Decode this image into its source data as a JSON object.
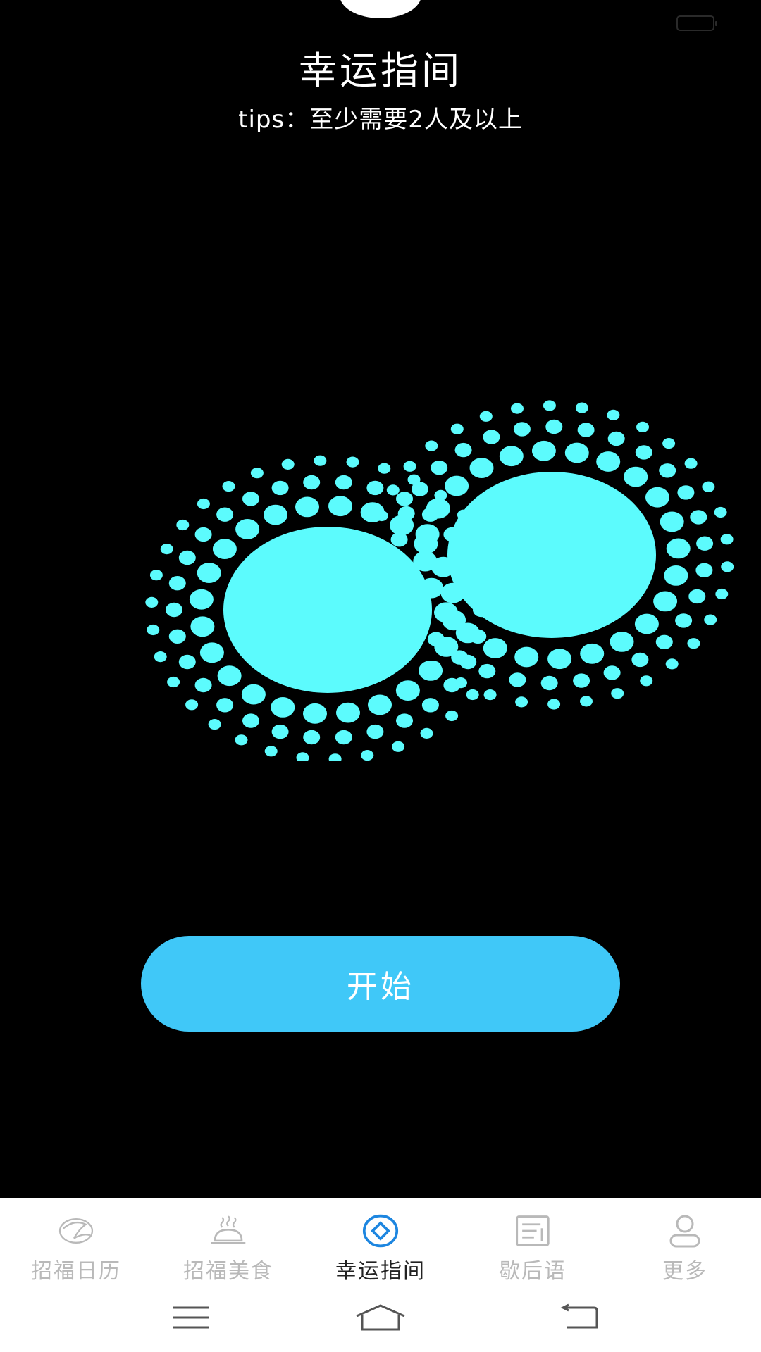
{
  "header": {
    "title": "幸运指间",
    "tips": "tips：至少需要2人及以上"
  },
  "main": {
    "start_label": "开始"
  },
  "colors": {
    "background": "#000000",
    "dot": "#5cfbfd",
    "button": "#40c8f8",
    "tab_active_icon": "#1d86e0",
    "tab_inactive": "#b9b9b9"
  },
  "tabs": [
    {
      "label": "招福日历",
      "icon": "calendar-leaf-icon",
      "active": false
    },
    {
      "label": "招福美食",
      "icon": "food-cloche-icon",
      "active": false
    },
    {
      "label": "幸运指间",
      "icon": "compass-diamond-icon",
      "active": true
    },
    {
      "label": "歇后语",
      "icon": "document-icon",
      "active": false
    },
    {
      "label": "更多",
      "icon": "user-icon",
      "active": false
    }
  ],
  "system_nav": {
    "menu_icon": "menu-icon",
    "home_icon": "home-icon",
    "back_icon": "back-icon"
  }
}
